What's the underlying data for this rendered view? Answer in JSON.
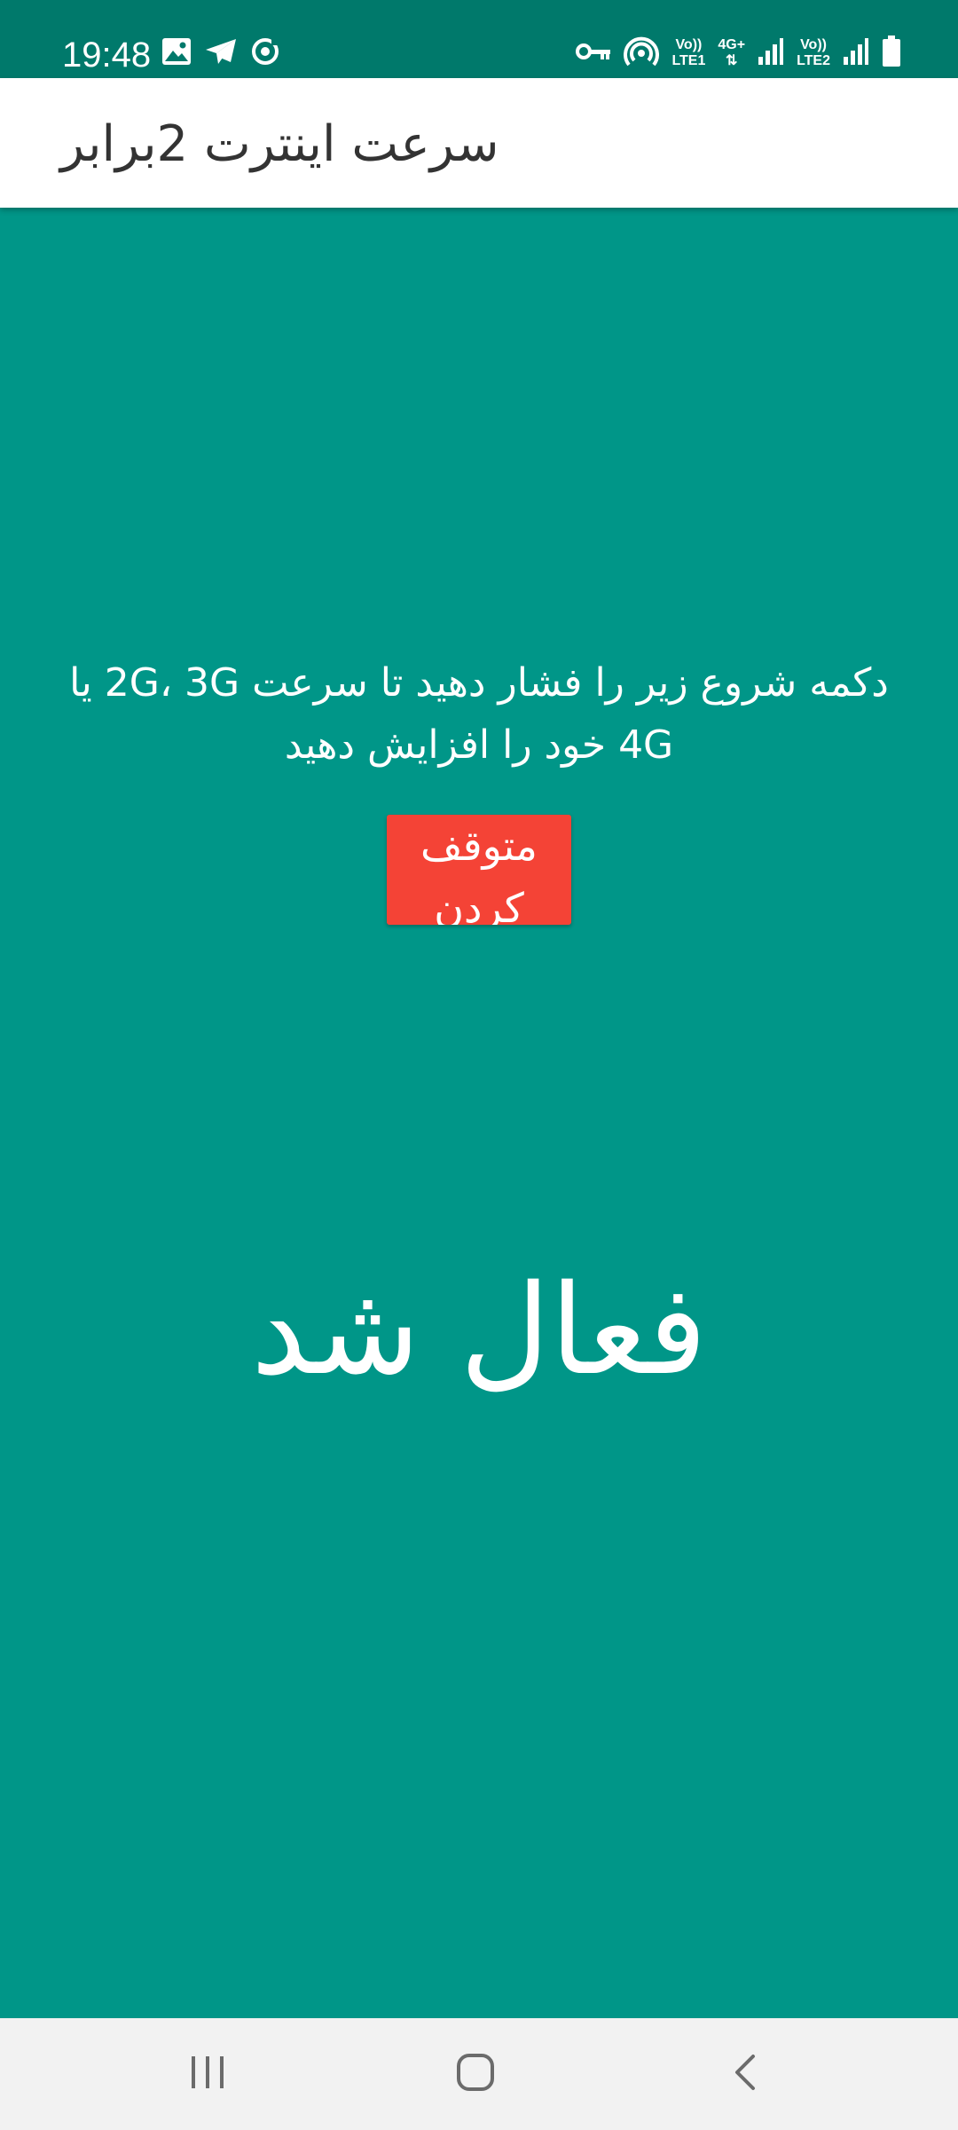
{
  "status_bar": {
    "time": "19:48",
    "left_icons": [
      "gallery-icon",
      "send-icon",
      "sync-icon"
    ],
    "right_icons": [
      "vpn-key-icon",
      "hotspot-icon",
      "signal-sim1-icon",
      "signal-sim2-icon",
      "battery-icon"
    ],
    "sim1_label_top": "Vo))",
    "sim1_label_bottom": "LTE1",
    "network_type": "4G+",
    "sim2_label_top": "Vo))",
    "sim2_label_bottom": "LTE2"
  },
  "app_bar": {
    "title": "سرعت اینترت 2برابر"
  },
  "main": {
    "instruction": "دکمه شروع زیر را فشار دهید تا سرعت 2G، 3G یا 4G خود را افزایش دهید",
    "stop_button_label": "متوقف کردن",
    "status_text": "فعال شد"
  },
  "colors": {
    "background": "#009688",
    "status_bar": "#00796b",
    "button": "#f44336",
    "nav_bar": "#f2f2f2"
  },
  "nav_bar": {
    "buttons": [
      "recents-icon",
      "home-icon",
      "back-icon"
    ]
  }
}
